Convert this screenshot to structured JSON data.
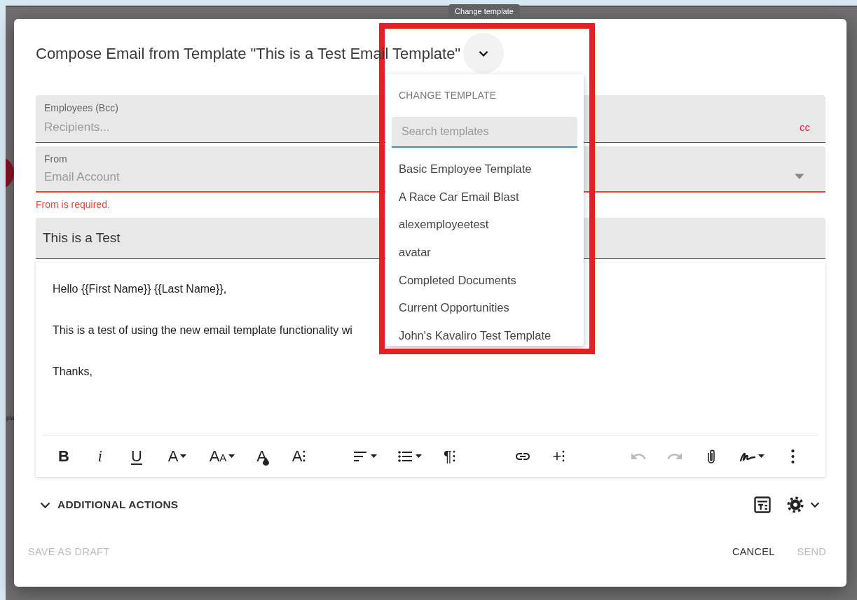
{
  "tooltip": {
    "text": "Change template"
  },
  "background_fragment": "pla",
  "dialog": {
    "title": "Compose Email from Template \"This is a Test Email Template\"",
    "recipients": {
      "label": "Employees (Bcc)",
      "placeholder": "Recipients...",
      "cc_link": "cc"
    },
    "from": {
      "label": "From",
      "placeholder": "Email Account",
      "error": "From is required.",
      "invalid": true
    },
    "subject": {
      "value": "This is a Test"
    },
    "body": [
      "Hello {{First Name}} {{Last Name}},",
      "This is a test of using the new email template functionality wi",
      "Thanks,"
    ],
    "toolbar_groups": [
      [
        {
          "kind": "bold",
          "label": "B",
          "caret": false,
          "disabled": false
        },
        {
          "kind": "italic",
          "label": "i",
          "caret": false,
          "disabled": false
        },
        {
          "kind": "underline",
          "label": "U",
          "caret": false,
          "disabled": false
        },
        {
          "kind": "glyph",
          "label": "A",
          "caret": true,
          "disabled": false
        },
        {
          "kind": "shrink",
          "label": "AA",
          "caret": true,
          "disabled": false
        },
        {
          "kind": "drop",
          "label": "A",
          "caret": false,
          "disabled": false
        },
        {
          "kind": "glyph",
          "label": "A⁝",
          "caret": false,
          "disabled": false
        }
      ],
      [
        {
          "kind": "align",
          "caret": true,
          "disabled": false
        },
        {
          "kind": "list",
          "caret": true,
          "disabled": false
        },
        {
          "kind": "glyph",
          "label": "¶⁝",
          "caret": false,
          "disabled": false
        }
      ],
      [
        {
          "kind": "link",
          "caret": false,
          "disabled": false
        },
        {
          "kind": "glyph",
          "label": "+⁝",
          "caret": false,
          "disabled": false
        }
      ],
      [
        {
          "kind": "undo",
          "caret": false,
          "disabled": true
        },
        {
          "kind": "redo",
          "caret": false,
          "disabled": true
        },
        {
          "kind": "attach",
          "caret": false,
          "disabled": false
        },
        {
          "kind": "signature",
          "caret": true,
          "disabled": false
        },
        {
          "kind": "more",
          "caret": false,
          "disabled": false
        }
      ]
    ],
    "additional_actions": {
      "label": "ADDITIONAL ACTIONS",
      "expanded": false
    },
    "footer": {
      "save_draft": {
        "label": "SAVE AS DRAFT",
        "disabled": true
      },
      "cancel": {
        "label": "CANCEL",
        "disabled": false
      },
      "send": {
        "label": "SEND",
        "disabled": true
      }
    }
  },
  "template_menu": {
    "header": "CHANGE TEMPLATE",
    "search_placeholder": "Search templates",
    "items": [
      "Basic Employee Template",
      "A Race Car Email Blast",
      "alexemployeetest",
      "avatar",
      "Completed Documents",
      "Current Opportunities",
      "John's Kavaliro Test Template"
    ]
  }
}
